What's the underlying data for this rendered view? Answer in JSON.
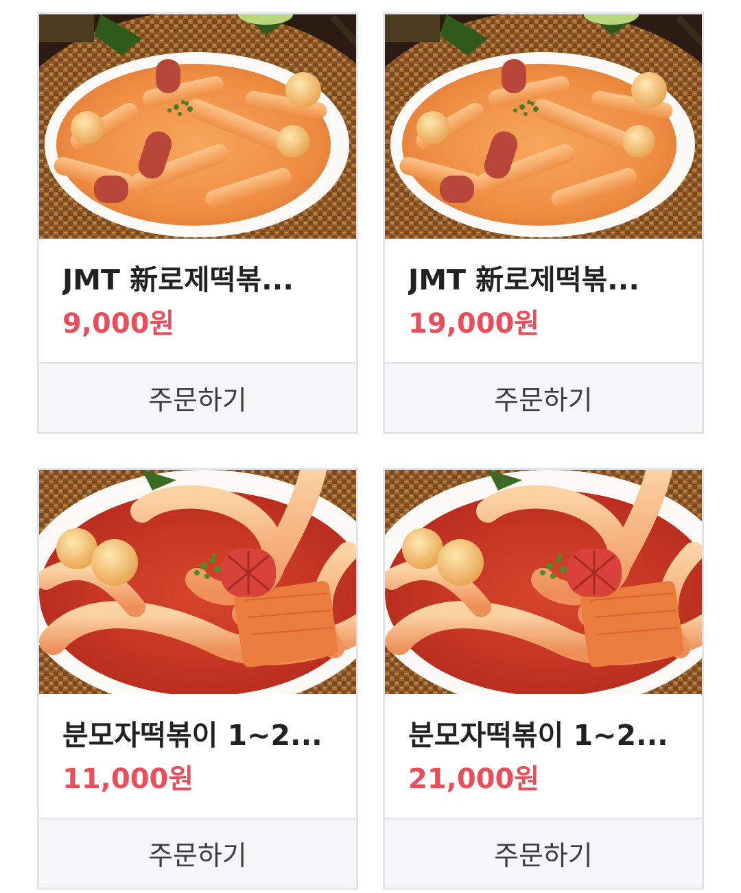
{
  "products": [
    {
      "name": "JMT 新로제떡볶...",
      "price": "9,000원",
      "order_label": "주문하기",
      "image": "rose-tteokbokki-photo"
    },
    {
      "name": "JMT 新로제떡볶...",
      "price": "19,000원",
      "order_label": "주문하기",
      "image": "rose-tteokbokki-photo"
    },
    {
      "name": "분모자떡볶이 1~2...",
      "price": "11,000원",
      "order_label": "주문하기",
      "image": "bunmoja-tteokbokki-photo"
    },
    {
      "name": "분모자떡볶이 1~2...",
      "price": "21,000원",
      "order_label": "주문하기",
      "image": "bunmoja-tteokbokki-photo"
    }
  ],
  "colors": {
    "price": "#e84f5b",
    "border": "#e3e5e8",
    "button_bg": "#f5f6f8"
  }
}
